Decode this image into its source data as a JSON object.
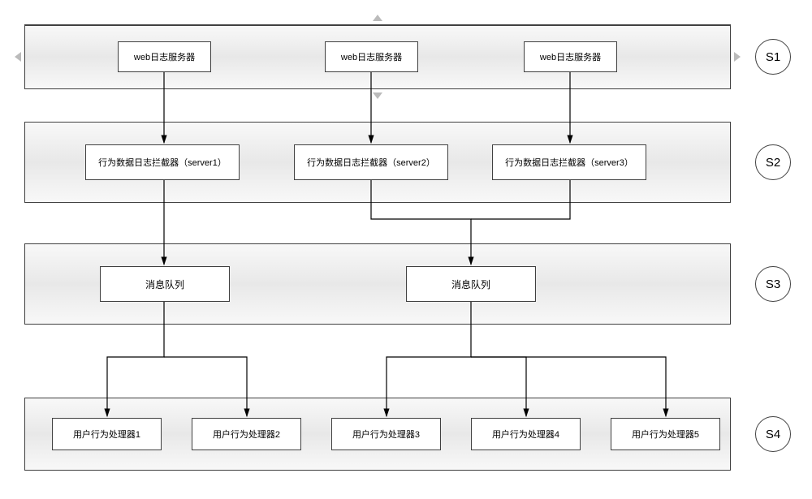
{
  "stages": {
    "s1": "S1",
    "s2": "S2",
    "s3": "S3",
    "s4": "S4"
  },
  "s1_boxes": [
    "web日志服务器",
    "web日志服务器",
    "web日志服务器"
  ],
  "s2_boxes": [
    "行为数据日志拦截器（server1）",
    "行为数据日志拦截器（server2）",
    "行为数据日志拦截器（server3）"
  ],
  "s3_boxes": [
    "消息队列",
    "消息队列"
  ],
  "s4_boxes": [
    "用户行为处理器1",
    "用户行为处理器2",
    "用户行为处理器3",
    "用户行为处理器4",
    "用户行为处理器5"
  ]
}
